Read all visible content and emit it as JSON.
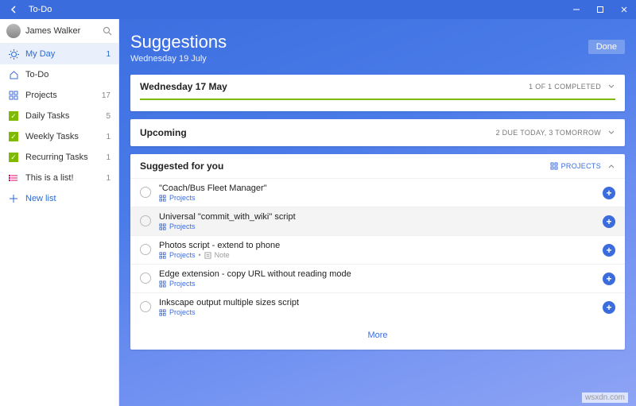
{
  "titlebar": {
    "app_name": "To-Do"
  },
  "profile": {
    "name": "James Walker"
  },
  "sidebar": {
    "items": [
      {
        "icon": "sun",
        "label": "My Day",
        "count": "1",
        "active": true
      },
      {
        "icon": "home",
        "label": "To-Do",
        "count": ""
      },
      {
        "icon": "grid",
        "label": "Projects",
        "count": "17"
      },
      {
        "icon": "check",
        "label": "Daily Tasks",
        "count": "5"
      },
      {
        "icon": "check",
        "label": "Weekly Tasks",
        "count": "1"
      },
      {
        "icon": "check",
        "label": "Recurring Tasks",
        "count": "1"
      },
      {
        "icon": "list",
        "label": "This is a list!",
        "count": "1"
      }
    ],
    "new_list": "New list"
  },
  "hero": {
    "title": "Suggestions",
    "subtitle": "Wednesday 19 July",
    "done": "Done"
  },
  "cards": {
    "past": {
      "title": "Wednesday 17 May",
      "meta": "1 OF 1 COMPLETED"
    },
    "upcoming": {
      "title": "Upcoming",
      "meta": "2 DUE TODAY, 3 TOMORROW"
    },
    "suggested": {
      "title": "Suggested for you",
      "source": "PROJECTS",
      "tasks": [
        {
          "title": "\"Coach/Bus Fleet Manager\"",
          "list": "Projects",
          "note": ""
        },
        {
          "title": "Universal \"commit_with_wiki\" script",
          "list": "Projects",
          "note": ""
        },
        {
          "title": "Photos script - extend to phone",
          "list": "Projects",
          "note": "Note"
        },
        {
          "title": "Edge extension - copy URL without reading mode",
          "list": "Projects",
          "note": ""
        },
        {
          "title": "Inkscape output multiple sizes script",
          "list": "Projects",
          "note": ""
        }
      ],
      "more": "More"
    }
  },
  "watermark": "wsxdn.com"
}
